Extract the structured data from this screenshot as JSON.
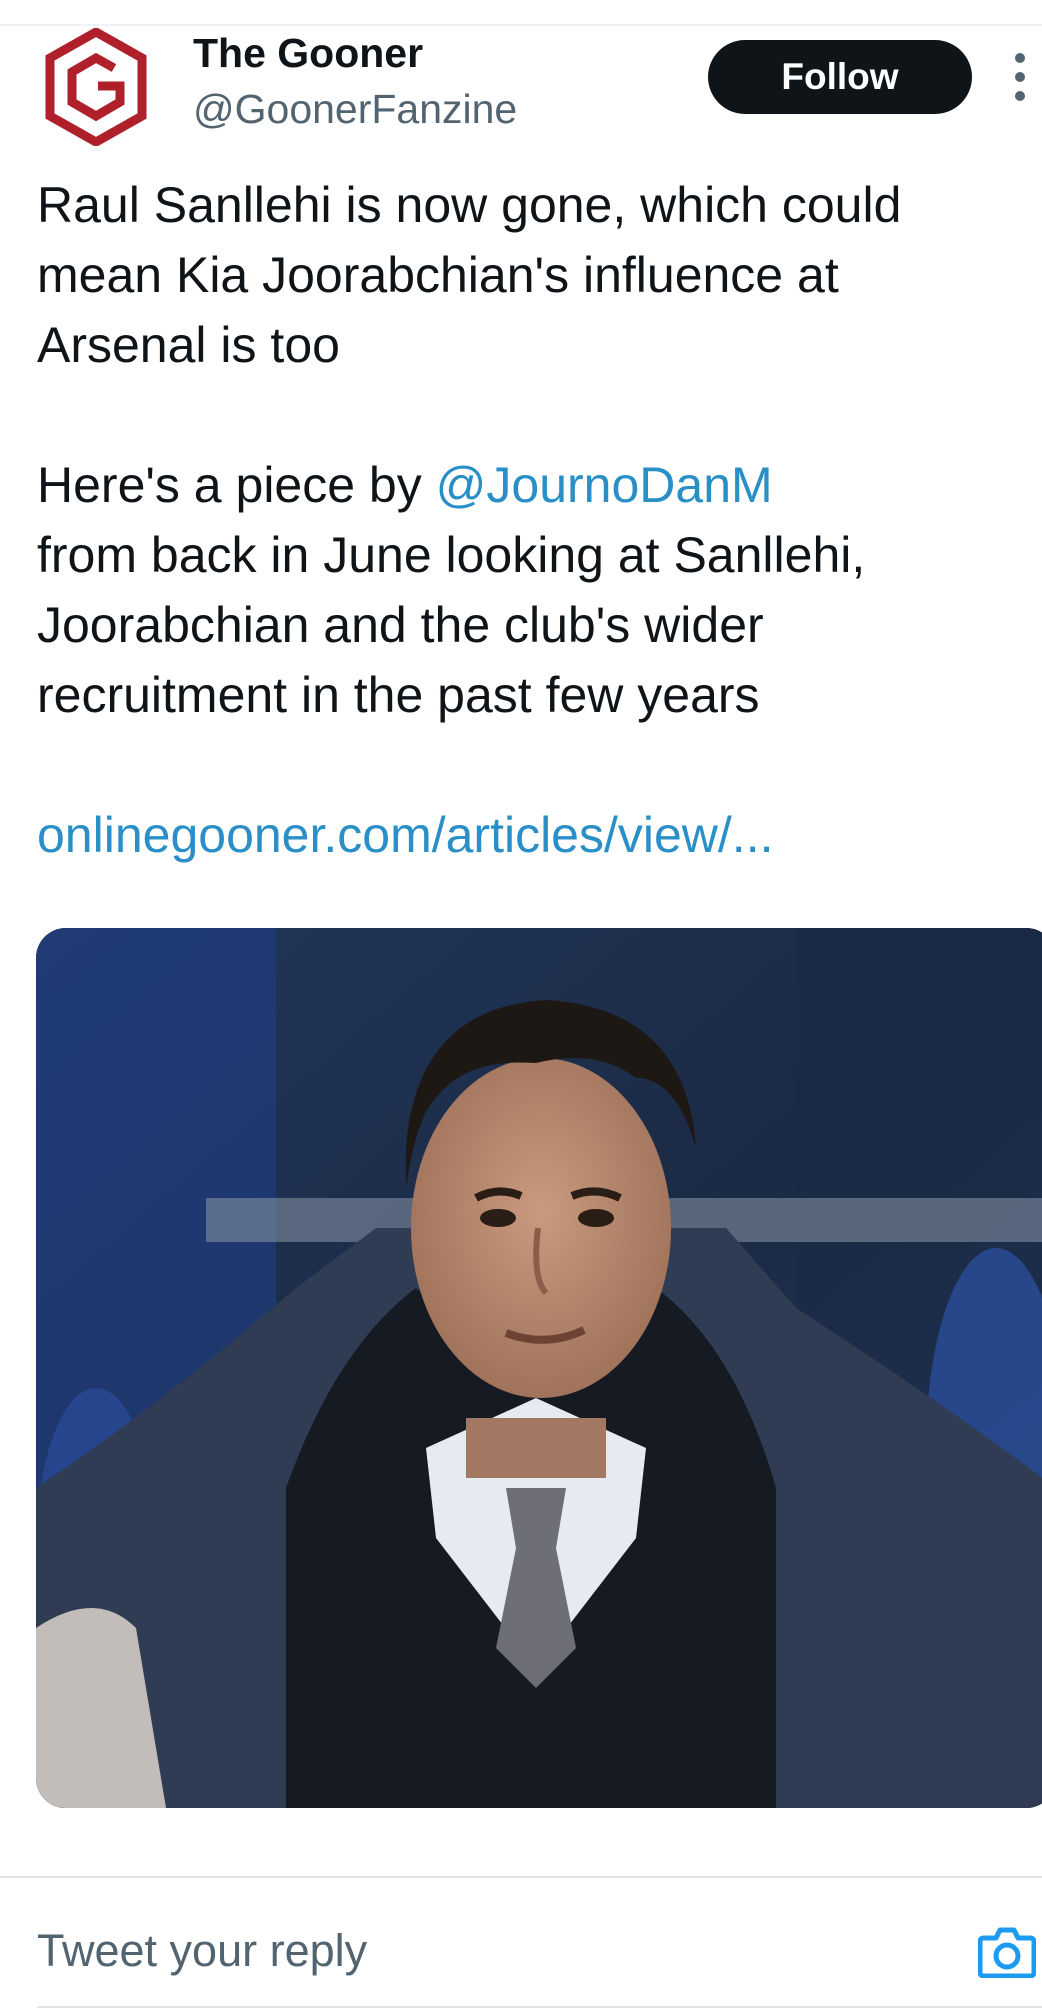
{
  "author": {
    "display_name": "The Gooner",
    "handle": "@GoonerFanzine",
    "avatar_icon": "gooner-g-logo-icon"
  },
  "actions": {
    "follow_label": "Follow",
    "more_icon": "more-vertical-icon"
  },
  "tweet": {
    "lines_1": [
      "Raul Sanllehi is now gone, which could",
      "mean Kia Joorabchian's influence at",
      "Arsenal is too"
    ],
    "lines_2_prefix": "Here's a piece by ",
    "mention": "@JournoDanM",
    "lines_2": [
      "from back in June looking at Sanllehi,",
      "Joorabchian and the club's wider",
      "recruitment in the past few years"
    ],
    "link": "onlinegooner.com/articles/view/..."
  },
  "media": {
    "type": "photo"
  },
  "reply": {
    "placeholder": "Tweet your reply",
    "camera_icon": "camera-icon"
  },
  "colors": {
    "link": "#2a8fc7",
    "button_bg": "#0f1419",
    "logo_red": "#b0202a"
  }
}
